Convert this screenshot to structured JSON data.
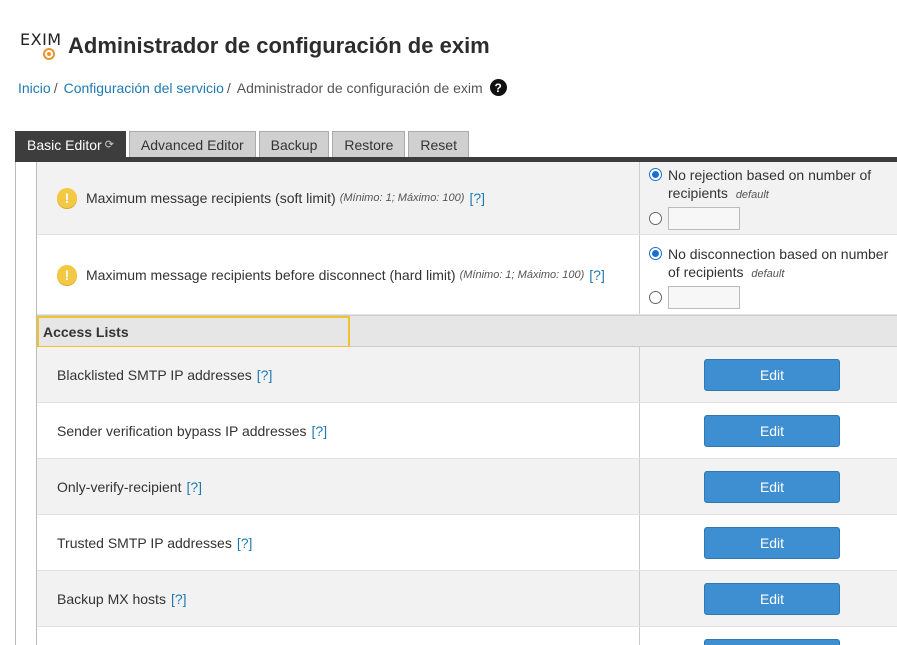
{
  "header": {
    "logo_text": "EXIM",
    "title": "Administrador de configuración de exim"
  },
  "breadcrumb": {
    "items": [
      "Inicio",
      "Configuración del servicio"
    ],
    "current": "Administrador de configuración de exim",
    "separator": "/"
  },
  "tabs": [
    {
      "label": "Basic Editor",
      "active": true
    },
    {
      "label": "Advanced Editor",
      "active": false
    },
    {
      "label": "Backup",
      "active": false
    },
    {
      "label": "Restore",
      "active": false
    },
    {
      "label": "Reset",
      "active": false
    }
  ],
  "settings": [
    {
      "label": "Maximum message recipients (soft limit)",
      "minmax": "(Mínimo: 1; Máximo: 100)",
      "help": "[?]",
      "option_default": "No rejection based on number of recipients",
      "default_tag": "default"
    },
    {
      "label": "Maximum message recipients before disconnect (hard limit)",
      "minmax": "(Mínimo: 1; Máximo: 100)",
      "help": "[?]",
      "option_default": "No disconnection based on number of recipients",
      "default_tag": "default"
    }
  ],
  "access_lists": {
    "title": "Access Lists",
    "edit_label": "Edit",
    "items": [
      {
        "label": "Blacklisted SMTP IP addresses",
        "help": "[?]"
      },
      {
        "label": "Sender verification bypass IP addresses",
        "help": "[?]"
      },
      {
        "label": "Only-verify-recipient",
        "help": "[?]"
      },
      {
        "label": "Trusted SMTP IP addresses",
        "help": "[?]"
      },
      {
        "label": "Backup MX hosts",
        "help": "[?]"
      }
    ]
  },
  "colors": {
    "accent_blue": "#3d8fd1",
    "link_blue": "#1f7ab3",
    "active_tab": "#3d3d3d",
    "highlight": "#f2c12e",
    "warning": "#f3c944"
  }
}
